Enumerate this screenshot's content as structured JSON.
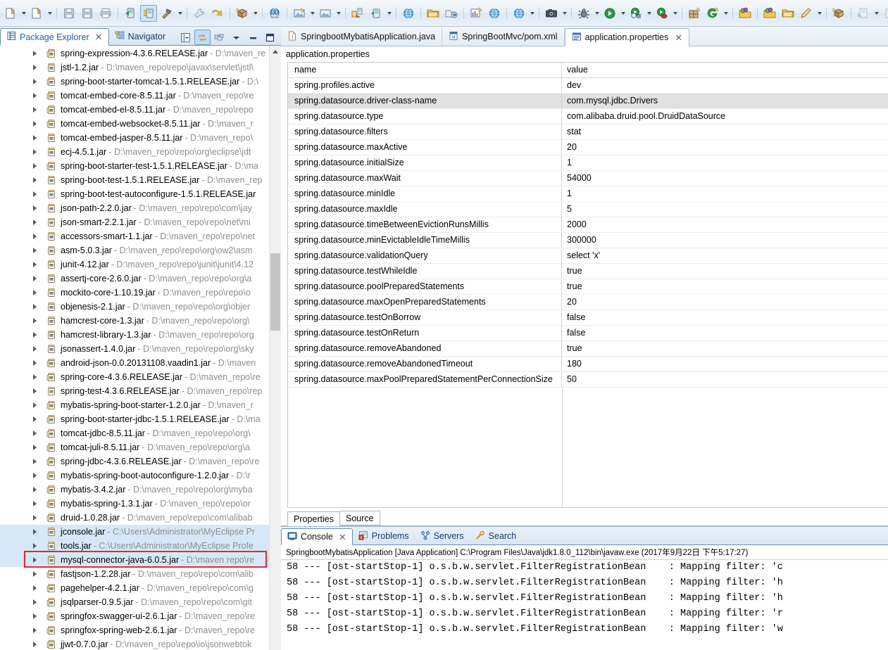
{
  "toolbar": {
    "groups": [
      {
        "items": [
          {
            "icon": "new-wizard-icon",
            "arrow": true
          },
          {
            "icon": "new-java-project-icon",
            "arrow": true
          }
        ]
      },
      {
        "items": [
          {
            "icon": "save-icon",
            "arrow": false
          },
          {
            "icon": "save-all-icon",
            "arrow": false
          },
          {
            "icon": "print-icon",
            "arrow": false
          }
        ]
      },
      {
        "items": [
          {
            "icon": "run-server-icon",
            "arrow": false
          },
          {
            "icon": "deploy-icon",
            "arrow": false,
            "selected": true
          },
          {
            "icon": "build-hammer-icon",
            "arrow": true
          }
        ]
      },
      {
        "items": [
          {
            "icon": "quick-fix-icon",
            "arrow": false
          },
          {
            "icon": "next-annotation-icon",
            "arrow": false
          }
        ]
      },
      {
        "items": [
          {
            "icon": "myeclipse-package-icon",
            "arrow": true
          }
        ]
      },
      {
        "items": [
          {
            "icon": "web20-browser-icon",
            "arrow": false
          }
        ]
      },
      {
        "items": [
          {
            "icon": "new-image-icon",
            "arrow": true
          },
          {
            "icon": "open-image-icon",
            "arrow": true
          }
        ]
      },
      {
        "items": [
          {
            "icon": "import-db-icon",
            "arrow": false
          },
          {
            "icon": "run-db-icon",
            "arrow": true
          }
        ]
      },
      {
        "items": [
          {
            "icon": "globe-icon",
            "arrow": false
          }
        ]
      },
      {
        "items": [
          {
            "icon": "open-folder-icon",
            "arrow": false
          },
          {
            "icon": "export-icon",
            "arrow": false
          }
        ]
      },
      {
        "items": [
          {
            "icon": "chart-report-icon",
            "arrow": false
          },
          {
            "icon": "globe-web-icon",
            "arrow": false
          }
        ]
      },
      {
        "items": [
          {
            "icon": "globe-link-icon",
            "arrow": true
          }
        ]
      },
      {
        "items": [
          {
            "icon": "camera-snapshot-icon",
            "arrow": true
          }
        ]
      },
      {
        "items": [
          {
            "icon": "debug-bug-icon",
            "arrow": true
          },
          {
            "icon": "run-play-icon",
            "arrow": true
          },
          {
            "icon": "run-history-icon",
            "arrow": true
          },
          {
            "icon": "run-coverage-icon",
            "arrow": true
          }
        ]
      },
      {
        "items": [
          {
            "icon": "new-plugin-icon",
            "arrow": false
          },
          {
            "icon": "git-icon",
            "arrow": true
          }
        ]
      },
      {
        "items": [
          {
            "icon": "open-type-yellow-icon",
            "arrow": false
          }
        ]
      },
      {
        "items": [
          {
            "icon": "open-task-icon",
            "arrow": false
          },
          {
            "icon": "open-folder-yellow-icon",
            "arrow": false
          },
          {
            "icon": "pencil-edit-icon",
            "arrow": true
          }
        ]
      },
      {
        "items": [
          {
            "icon": "open-package-icon",
            "arrow": false
          }
        ]
      },
      {
        "items": [
          {
            "icon": "previous-edit-icon",
            "arrow": true
          },
          {
            "icon": "last-edit-icon",
            "arrow": true
          }
        ]
      },
      {
        "items": [
          {
            "icon": "back-arrow-icon",
            "arrow": false
          },
          {
            "icon": "back-arrow2-icon",
            "arrow": true
          },
          {
            "icon": "forward-arrow-icon",
            "arrow": true
          }
        ]
      },
      {
        "items": [
          {
            "icon": "new-window-icon",
            "arrow": false
          }
        ]
      }
    ]
  },
  "package_explorer": {
    "tabs": [
      {
        "label": "Package Explorer",
        "icon": "package-explorer-icon",
        "active": true,
        "closable": true
      },
      {
        "label": "Navigator",
        "icon": "navigator-icon",
        "active": false,
        "closable": false
      }
    ],
    "view_tools": [
      {
        "name": "collapse-all-icon",
        "on": false
      },
      {
        "name": "link-with-editor-icon",
        "on": true
      },
      {
        "name": "view-filter-icon",
        "on": false
      },
      {
        "name": "view-menu-icon",
        "on": false
      },
      {
        "name": "minimize-icon",
        "on": false
      },
      {
        "name": "maximize-icon",
        "on": false
      }
    ],
    "items": [
      {
        "name": "spring-expression-4.3.6.RELEASE.jar",
        "path": "- D:\\maven_re",
        "icon": "jar-src-icon"
      },
      {
        "name": "jstl-1.2.jar",
        "path": "- D:\\maven_repo\\repo\\javax\\servlet\\jstl\\",
        "icon": "jar-icon"
      },
      {
        "name": "spring-boot-starter-tomcat-1.5.1.RELEASE.jar",
        "path": "- D:\\",
        "icon": "jar-src-icon"
      },
      {
        "name": "tomcat-embed-core-8.5.11.jar",
        "path": "- D:\\maven_repo\\re",
        "icon": "jar-src-icon"
      },
      {
        "name": "tomcat-embed-el-8.5.11.jar",
        "path": "- D:\\maven_repo\\repo",
        "icon": "jar-src-icon"
      },
      {
        "name": "tomcat-embed-websocket-8.5.11.jar",
        "path": "- D:\\maven_r",
        "icon": "jar-src-icon"
      },
      {
        "name": "tomcat-embed-jasper-8.5.11.jar",
        "path": "- D:\\maven_repo\\",
        "icon": "jar-icon"
      },
      {
        "name": "ecj-4.5.1.jar",
        "path": "- D:\\maven_repo\\repo\\org\\eclipse\\jdt",
        "icon": "jar-icon"
      },
      {
        "name": "spring-boot-starter-test-1.5.1.RELEASE.jar",
        "path": "- D:\\ma",
        "icon": "jar-src-icon"
      },
      {
        "name": "spring-boot-test-1.5.1.RELEASE.jar",
        "path": "- D:\\maven_rep",
        "icon": "jar-icon"
      },
      {
        "name": "spring-boot-test-autoconfigure-1.5.1.RELEASE.jar",
        "path": "",
        "icon": "jar-icon"
      },
      {
        "name": "json-path-2.2.0.jar",
        "path": "- D:\\maven_repo\\repo\\com\\jay",
        "icon": "jar-icon"
      },
      {
        "name": "json-smart-2.2.1.jar",
        "path": "- D:\\maven_repo\\repo\\net\\mi",
        "icon": "jar-icon"
      },
      {
        "name": "accessors-smart-1.1.jar",
        "path": "- D:\\maven_repo\\repo\\net",
        "icon": "jar-icon"
      },
      {
        "name": "asm-5.0.3.jar",
        "path": "- D:\\maven_repo\\repo\\org\\ow2\\asm",
        "icon": "jar-icon"
      },
      {
        "name": "junit-4.12.jar",
        "path": "- D:\\maven_repo\\repo\\junit\\junit\\4.12",
        "icon": "jar-icon"
      },
      {
        "name": "assertj-core-2.6.0.jar",
        "path": "- D:\\maven_repo\\repo\\org\\a",
        "icon": "jar-icon"
      },
      {
        "name": "mockito-core-1.10.19.jar",
        "path": "- D:\\maven_repo\\repo\\o",
        "icon": "jar-icon"
      },
      {
        "name": "objenesis-2.1.jar",
        "path": "- D:\\maven_repo\\repo\\org\\objer",
        "icon": "jar-icon"
      },
      {
        "name": "hamcrest-core-1.3.jar",
        "path": "- D:\\maven_repo\\repo\\org\\",
        "icon": "jar-icon"
      },
      {
        "name": "hamcrest-library-1.3.jar",
        "path": "- D:\\maven_repo\\repo\\org",
        "icon": "jar-icon"
      },
      {
        "name": "jsonassert-1.4.0.jar",
        "path": "- D:\\maven_repo\\repo\\org\\sky",
        "icon": "jar-icon"
      },
      {
        "name": "android-json-0.0.20131108.vaadin1.jar",
        "path": "- D:\\maven",
        "icon": "jar-src-icon"
      },
      {
        "name": "spring-core-4.3.6.RELEASE.jar",
        "path": "- D:\\maven_repo\\re",
        "icon": "jar-src-icon"
      },
      {
        "name": "spring-test-4.3.6.RELEASE.jar",
        "path": "- D:\\maven_repo\\rep",
        "icon": "jar-icon"
      },
      {
        "name": "mybatis-spring-boot-starter-1.2.0.jar",
        "path": "- D:\\maven_r",
        "icon": "jar-src-icon"
      },
      {
        "name": "spring-boot-starter-jdbc-1.5.1.RELEASE.jar",
        "path": "- D:\\ma",
        "icon": "jar-src-icon"
      },
      {
        "name": "tomcat-jdbc-8.5.11.jar",
        "path": "- D:\\maven_repo\\repo\\org\\",
        "icon": "jar-src-icon"
      },
      {
        "name": "tomcat-juli-8.5.11.jar",
        "path": "- D:\\maven_repo\\repo\\org\\a",
        "icon": "jar-src-icon"
      },
      {
        "name": "spring-jdbc-4.3.6.RELEASE.jar",
        "path": "- D:\\maven_repo\\re",
        "icon": "jar-src-icon"
      },
      {
        "name": "mybatis-spring-boot-autoconfigure-1.2.0.jar",
        "path": "- D:\\r",
        "icon": "jar-src-icon"
      },
      {
        "name": "mybatis-3.4.2.jar",
        "path": "- D:\\maven_repo\\repo\\org\\myba",
        "icon": "jar-src-icon"
      },
      {
        "name": "mybatis-spring-1.3.1.jar",
        "path": "- D:\\maven_repo\\repo\\or",
        "icon": "jar-src-icon"
      },
      {
        "name": "druid-1.0.28.jar",
        "path": "- D:\\maven_repo\\repo\\com\\alibab",
        "icon": "jar-src-icon"
      },
      {
        "name": "jconsole.jar",
        "path": "- C:\\Users\\Administrator\\MyEclipse Pr",
        "icon": "jar-icon",
        "selected": true
      },
      {
        "name": "tools.jar",
        "path": "- C:\\Users\\Administrator\\MyEclipse Profe",
        "icon": "jar-icon",
        "selected": true
      },
      {
        "name": "mysql-connector-java-6.0.5.jar",
        "path": "- D:\\maven repo\\re",
        "icon": "jar-icon",
        "selected": true,
        "highlighted": true
      },
      {
        "name": "fastjson-1.2.28.jar",
        "path": "- D:\\maven_repo\\repo\\com\\alib",
        "icon": "jar-src-icon"
      },
      {
        "name": "pagehelper-4.2.1.jar",
        "path": "- D:\\maven_repo\\repo\\com\\g",
        "icon": "jar-src-icon"
      },
      {
        "name": "jsqlparser-0.9.5.jar",
        "path": "- D:\\maven_repo\\repo\\com\\git",
        "icon": "jar-src-icon"
      },
      {
        "name": "springfox-swagger-ui-2.6.1.jar",
        "path": "- D:\\maven_repo\\re",
        "icon": "jar-src-icon"
      },
      {
        "name": "springfox-spring-web-2.6.1.jar",
        "path": "- D:\\maven_repo\\re",
        "icon": "jar-src-icon"
      },
      {
        "name": "jjwt-0.7.0.jar",
        "path": "- D:\\maven_repo\\repo\\io\\jsonwebtok",
        "icon": "jar-src-icon"
      }
    ]
  },
  "editor": {
    "tabs": [
      {
        "label": "SpringbootMybatisApplication.java",
        "icon": "java-file-icon",
        "active": false,
        "closable": false
      },
      {
        "label": "SpringBootMvc/pom.xml",
        "icon": "maven-pom-icon",
        "active": false,
        "closable": false
      },
      {
        "label": "application.properties",
        "icon": "properties-file-icon",
        "active": true,
        "closable": true
      }
    ],
    "title": "application.properties",
    "table": {
      "columns": [
        "name",
        "value"
      ],
      "rows": [
        {
          "name": "spring.profiles.active",
          "value": "dev"
        },
        {
          "name": "spring.datasource.driver-class-name",
          "value": "com.mysql.jdbc.Drivers",
          "selected": true
        },
        {
          "name": "spring.datasource.type",
          "value": "com.alibaba.druid.pool.DruidDataSource"
        },
        {
          "name": "spring.datasource.filters",
          "value": "stat"
        },
        {
          "name": "spring.datasource.maxActive",
          "value": "20"
        },
        {
          "name": "spring.datasource.initialSize",
          "value": "1"
        },
        {
          "name": "spring.datasource.maxWait",
          "value": "54000"
        },
        {
          "name": "spring.datasource.minIdle",
          "value": "1"
        },
        {
          "name": "spring.datasource.maxIdle",
          "value": "5"
        },
        {
          "name": "spring.datasource.timeBetweenEvictionRunsMillis",
          "value": "2000"
        },
        {
          "name": "spring.datasource.minEvictableIdleTimeMillis",
          "value": "300000"
        },
        {
          "name": "spring.datasource.validationQuery",
          "value": "select 'x'"
        },
        {
          "name": "spring.datasource.testWhileIdle",
          "value": "true"
        },
        {
          "name": "spring.datasource.poolPreparedStatements",
          "value": "true"
        },
        {
          "name": "spring.datasource.maxOpenPreparedStatements",
          "value": "20"
        },
        {
          "name": "spring.datasource.testOnBorrow",
          "value": "false"
        },
        {
          "name": "spring.datasource.testOnReturn",
          "value": "false"
        },
        {
          "name": "spring.datasource.removeAbandoned",
          "value": "true"
        },
        {
          "name": "spring.datasource.removeAbandonedTimeout",
          "value": "180"
        },
        {
          "name": "spring.datasource.maxPoolPreparedStatementPerConnectionSize",
          "value": "50"
        }
      ]
    },
    "bottom_tabs": [
      {
        "label": "Properties",
        "active": true
      },
      {
        "label": "Source",
        "active": false
      }
    ]
  },
  "console": {
    "tabs": [
      {
        "label": "Console",
        "icon": "console-icon",
        "active": true,
        "closable": true
      },
      {
        "label": "Problems",
        "icon": "problems-icon",
        "active": false,
        "closable": false
      },
      {
        "label": "Servers",
        "icon": "servers-icon",
        "active": false,
        "closable": false
      },
      {
        "label": "Search",
        "icon": "search-icon",
        "active": false,
        "closable": false
      }
    ],
    "description": "SpringbootMybatisApplication [Java Application] C:\\Program Files\\Java\\jdk1.8.0_112\\bin\\javaw.exe (2017年9月22日 下午5:17:27)",
    "lines": [
      "58 --- [ost-startStop-1] o.s.b.w.servlet.FilterRegistrationBean    : Mapping filter: 'c",
      "58 --- [ost-startStop-1] o.s.b.w.servlet.FilterRegistrationBean    : Mapping filter: 'h",
      "58 --- [ost-startStop-1] o.s.b.w.servlet.FilterRegistrationBean    : Mapping filter: 'h",
      "58 --- [ost-startStop-1] o.s.b.w.servlet.FilterRegistrationBean    : Mapping filter: 'r",
      "58 --- [ost-startStop-1] o.s.b.w.servlet.FilterRegistrationBean    : Mapping filter: 'w"
    ]
  },
  "colors": {
    "accent": "#2a5d9e",
    "highlight_box": "#e8282b",
    "selection": "#d6e8f7",
    "row_selected": "#e1e1e1",
    "path_text": "#8d8d8d"
  }
}
